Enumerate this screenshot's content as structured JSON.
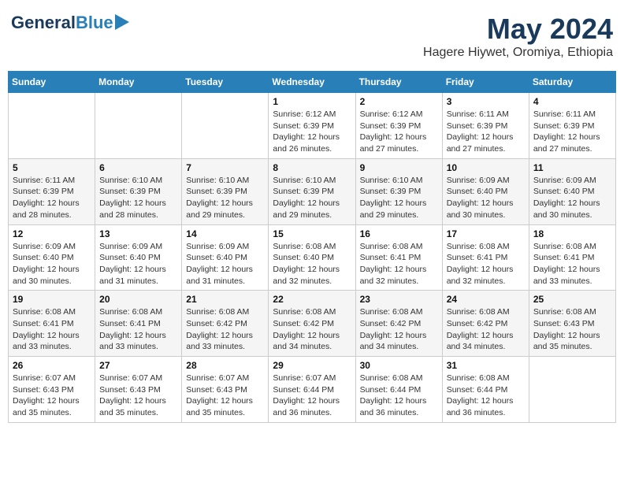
{
  "logo": {
    "general": "General",
    "blue": "Blue"
  },
  "title": "May 2024",
  "subtitle": "Hagere Hiywet, Oromiya, Ethiopia",
  "days_of_week": [
    "Sunday",
    "Monday",
    "Tuesday",
    "Wednesday",
    "Thursday",
    "Friday",
    "Saturday"
  ],
  "weeks": [
    [
      {
        "day": "",
        "info": ""
      },
      {
        "day": "",
        "info": ""
      },
      {
        "day": "",
        "info": ""
      },
      {
        "day": "1",
        "sunrise": "6:12 AM",
        "sunset": "6:39 PM",
        "daylight": "12 hours and 26 minutes."
      },
      {
        "day": "2",
        "sunrise": "6:12 AM",
        "sunset": "6:39 PM",
        "daylight": "12 hours and 27 minutes."
      },
      {
        "day": "3",
        "sunrise": "6:11 AM",
        "sunset": "6:39 PM",
        "daylight": "12 hours and 27 minutes."
      },
      {
        "day": "4",
        "sunrise": "6:11 AM",
        "sunset": "6:39 PM",
        "daylight": "12 hours and 27 minutes."
      }
    ],
    [
      {
        "day": "5",
        "sunrise": "6:11 AM",
        "sunset": "6:39 PM",
        "daylight": "12 hours and 28 minutes."
      },
      {
        "day": "6",
        "sunrise": "6:10 AM",
        "sunset": "6:39 PM",
        "daylight": "12 hours and 28 minutes."
      },
      {
        "day": "7",
        "sunrise": "6:10 AM",
        "sunset": "6:39 PM",
        "daylight": "12 hours and 29 minutes."
      },
      {
        "day": "8",
        "sunrise": "6:10 AM",
        "sunset": "6:39 PM",
        "daylight": "12 hours and 29 minutes."
      },
      {
        "day": "9",
        "sunrise": "6:10 AM",
        "sunset": "6:39 PM",
        "daylight": "12 hours and 29 minutes."
      },
      {
        "day": "10",
        "sunrise": "6:09 AM",
        "sunset": "6:40 PM",
        "daylight": "12 hours and 30 minutes."
      },
      {
        "day": "11",
        "sunrise": "6:09 AM",
        "sunset": "6:40 PM",
        "daylight": "12 hours and 30 minutes."
      }
    ],
    [
      {
        "day": "12",
        "sunrise": "6:09 AM",
        "sunset": "6:40 PM",
        "daylight": "12 hours and 30 minutes."
      },
      {
        "day": "13",
        "sunrise": "6:09 AM",
        "sunset": "6:40 PM",
        "daylight": "12 hours and 31 minutes."
      },
      {
        "day": "14",
        "sunrise": "6:09 AM",
        "sunset": "6:40 PM",
        "daylight": "12 hours and 31 minutes."
      },
      {
        "day": "15",
        "sunrise": "6:08 AM",
        "sunset": "6:40 PM",
        "daylight": "12 hours and 32 minutes."
      },
      {
        "day": "16",
        "sunrise": "6:08 AM",
        "sunset": "6:41 PM",
        "daylight": "12 hours and 32 minutes."
      },
      {
        "day": "17",
        "sunrise": "6:08 AM",
        "sunset": "6:41 PM",
        "daylight": "12 hours and 32 minutes."
      },
      {
        "day": "18",
        "sunrise": "6:08 AM",
        "sunset": "6:41 PM",
        "daylight": "12 hours and 33 minutes."
      }
    ],
    [
      {
        "day": "19",
        "sunrise": "6:08 AM",
        "sunset": "6:41 PM",
        "daylight": "12 hours and 33 minutes."
      },
      {
        "day": "20",
        "sunrise": "6:08 AM",
        "sunset": "6:41 PM",
        "daylight": "12 hours and 33 minutes."
      },
      {
        "day": "21",
        "sunrise": "6:08 AM",
        "sunset": "6:42 PM",
        "daylight": "12 hours and 33 minutes."
      },
      {
        "day": "22",
        "sunrise": "6:08 AM",
        "sunset": "6:42 PM",
        "daylight": "12 hours and 34 minutes."
      },
      {
        "day": "23",
        "sunrise": "6:08 AM",
        "sunset": "6:42 PM",
        "daylight": "12 hours and 34 minutes."
      },
      {
        "day": "24",
        "sunrise": "6:08 AM",
        "sunset": "6:42 PM",
        "daylight": "12 hours and 34 minutes."
      },
      {
        "day": "25",
        "sunrise": "6:08 AM",
        "sunset": "6:43 PM",
        "daylight": "12 hours and 35 minutes."
      }
    ],
    [
      {
        "day": "26",
        "sunrise": "6:07 AM",
        "sunset": "6:43 PM",
        "daylight": "12 hours and 35 minutes."
      },
      {
        "day": "27",
        "sunrise": "6:07 AM",
        "sunset": "6:43 PM",
        "daylight": "12 hours and 35 minutes."
      },
      {
        "day": "28",
        "sunrise": "6:07 AM",
        "sunset": "6:43 PM",
        "daylight": "12 hours and 35 minutes."
      },
      {
        "day": "29",
        "sunrise": "6:07 AM",
        "sunset": "6:44 PM",
        "daylight": "12 hours and 36 minutes."
      },
      {
        "day": "30",
        "sunrise": "6:08 AM",
        "sunset": "6:44 PM",
        "daylight": "12 hours and 36 minutes."
      },
      {
        "day": "31",
        "sunrise": "6:08 AM",
        "sunset": "6:44 PM",
        "daylight": "12 hours and 36 minutes."
      },
      {
        "day": "",
        "info": ""
      }
    ]
  ],
  "labels": {
    "sunrise": "Sunrise:",
    "sunset": "Sunset:",
    "daylight": "Daylight:"
  }
}
